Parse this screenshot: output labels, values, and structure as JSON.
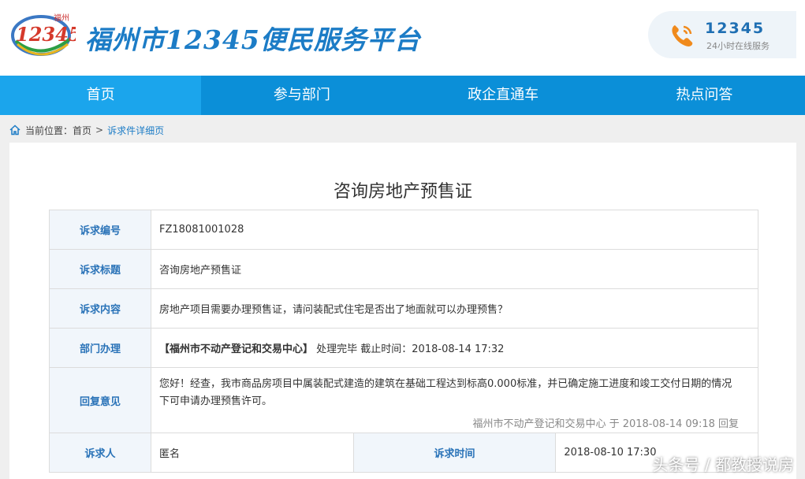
{
  "header": {
    "logo_city": "福州",
    "logo_number": "12345",
    "site_title": "福州市12345便民服务平台",
    "hotline_number": "12345",
    "hotline_sub": "24小时在线服务"
  },
  "nav": {
    "items": [
      "首页",
      "参与部门",
      "政企直通车",
      "热点问答"
    ],
    "active": 0
  },
  "breadcrumb": {
    "prefix": "当前位置：",
    "home": "首页",
    "separator": ">",
    "current": "诉求件详细页"
  },
  "detail": {
    "title": "咨询房地产预售证",
    "labels": {
      "id": "诉求编号",
      "subject": "诉求标题",
      "content": "诉求内容",
      "department": "部门办理",
      "reply": "回复意见",
      "petitioner": "诉求人",
      "time": "诉求时间"
    },
    "id": "FZ18081001028",
    "subject": "咨询房地产预售证",
    "content": "房地产项目需要办理预售证，请问装配式住宅是否出了地面就可以办理预售？",
    "department_name": "【福州市不动产登记和交易中心】",
    "department_status": "处理完毕 截止时间：2018-08-14 17:32",
    "reply_text": "您好！经查，我市商品房项目中属装配式建造的建筑在基础工程达到标高0.000标准，并已确定施工进度和竣工交付日期的情况下可申请办理预售许可。",
    "reply_meta": "福州市不动产登记和交易中心 于 2018-08-14 09:18 回复",
    "petitioner": "匿名",
    "time": "2018-08-10 17:30"
  },
  "watermark": "头条号 / 都教授说房",
  "colors": {
    "nav_bg": "#0b8fd8",
    "nav_active": "#1ba5ec",
    "title_blue": "#1c7cc6",
    "label_blue": "#2a73b8",
    "phone_orange": "#f08a1c"
  }
}
